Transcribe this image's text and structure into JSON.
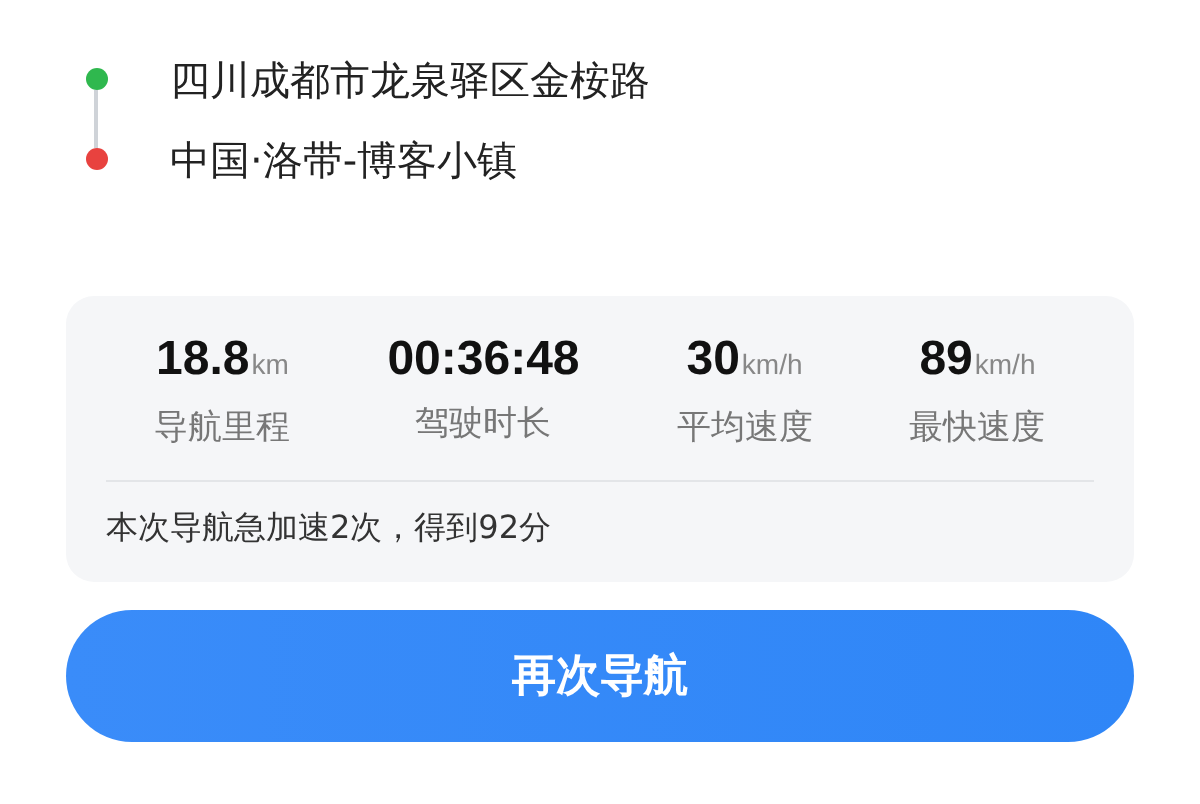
{
  "route": [
    {
      "address": "四川成都市龙泉驿区金桉路",
      "color": "#2fb84e"
    },
    {
      "address": "中国·洛带-博客小镇",
      "color": "#e8423f"
    }
  ],
  "stats": [
    {
      "value": "18.8",
      "unit": "km",
      "label": "导航里程"
    },
    {
      "value": "00:36:48",
      "label": "驾驶时长"
    },
    {
      "value": "30",
      "unit": "km/h",
      "label": "平均速度"
    },
    {
      "value": "89",
      "unit": "km/h",
      "label": "最快速度"
    }
  ],
  "summary": "本次导航急加速2次，得到92分",
  "button": "再次导航"
}
